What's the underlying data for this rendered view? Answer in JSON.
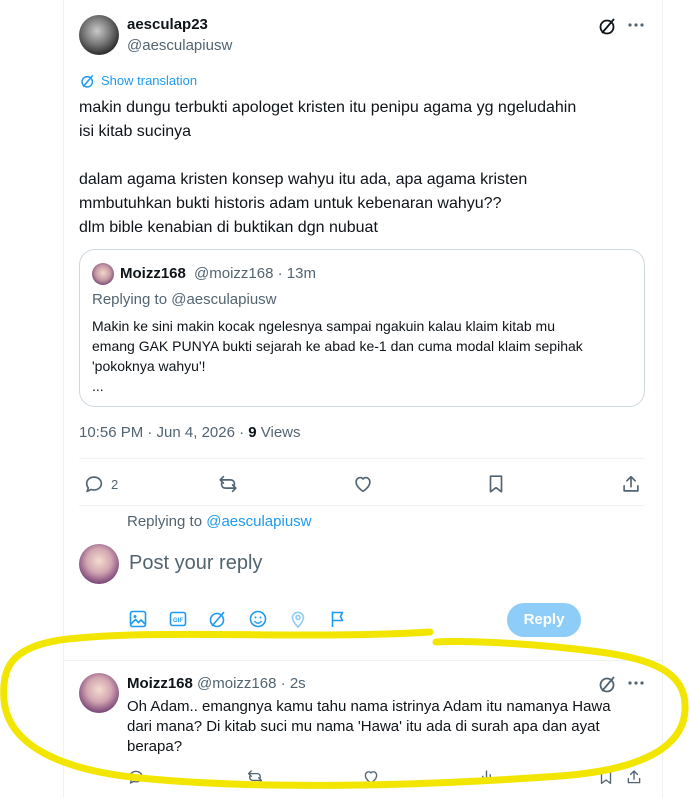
{
  "post": {
    "display_name": "aesculap23",
    "handle": "@aesculapiusw",
    "show_translation": "Show translation",
    "text_lines": [
      "makin dungu terbukti apologet kristen itu penipu agama yg ngeludahin",
      "isi kitab sucinya",
      "",
      "dalam agama kristen konsep wahyu itu ada, apa agama kristen",
      "mmbutuhkan bukti historis adam untuk kebenaran wahyu??",
      "dlm bible kenabian di buktikan dgn nubuat"
    ],
    "quote": {
      "display_name": "Moizz168",
      "handle": "@moizz168",
      "time": "13m",
      "replying_to_prefix": "Replying to ",
      "replying_to_handle": "@aesculapiusw",
      "text_lines": [
        "Makin ke sini makin kocak ngelesnya sampai ngakuin kalau klaim kitab mu",
        "emang GAK PUNYA bukti sejarah ke abad ke-1 dan cuma modal klaim sepihak",
        "'pokoknya wahyu'!",
        "..."
      ]
    },
    "timestamp": "10:56 PM · Jun 4, 2026 · ",
    "views_count": "9",
    "views_label": " Views",
    "reply_count": "2"
  },
  "composer": {
    "replying_prefix": "Replying to ",
    "replying_handle": "@aesculapiusw",
    "placeholder": "Post your reply",
    "reply_button": "Reply",
    "gif_label": "GIF"
  },
  "reply": {
    "display_name": "Moizz168",
    "handle": "@moizz168",
    "time": "2s",
    "text_lines": [
      "Oh Adam.. emangnya kamu tahu nama istrinya Adam itu namanya Hawa",
      "dari mana? Di kitab suci mu nama 'Hawa' itu ada di surah apa dan ayat",
      "berapa?"
    ]
  },
  "colors": {
    "accent": "#1d9bf0",
    "reply_button_disabled": "#8ecdf8",
    "annotation_highlight": "#f2e600",
    "muted_text": "#536471"
  }
}
